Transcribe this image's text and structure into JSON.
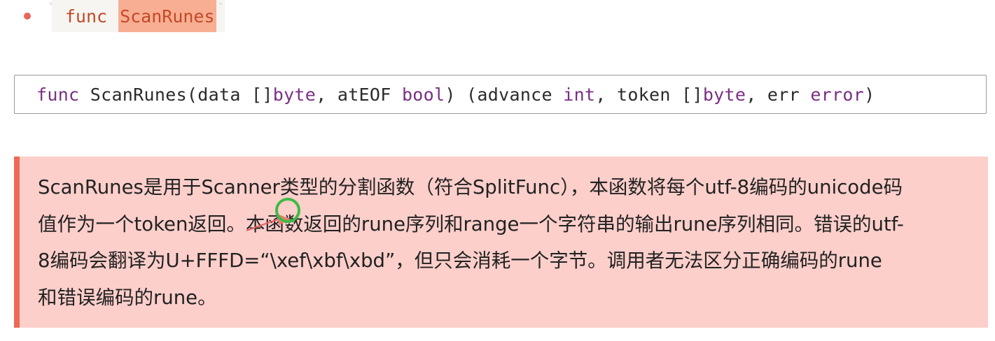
{
  "bullet": {
    "open_tick": "`",
    "keyword": "func",
    "name": "ScanRunes",
    "close_tick": "`"
  },
  "code_block": {
    "tokens": [
      {
        "text": "func",
        "kind": "kw"
      },
      {
        "text": " ScanRunes(data []",
        "kind": "plain"
      },
      {
        "text": "byte",
        "kind": "type"
      },
      {
        "text": ", atEOF ",
        "kind": "plain"
      },
      {
        "text": "bool",
        "kind": "type"
      },
      {
        "text": ") (advance ",
        "kind": "plain"
      },
      {
        "text": "int",
        "kind": "type"
      },
      {
        "text": ", token []",
        "kind": "plain"
      },
      {
        "text": "byte",
        "kind": "type"
      },
      {
        "text": ", err ",
        "kind": "plain"
      },
      {
        "text": "error",
        "kind": "type"
      },
      {
        "text": ")",
        "kind": "plain"
      }
    ]
  },
  "callout": {
    "lines": [
      "ScanRunes是用于Scanner类型的分割函数（符合SplitFunc），本函数将每个utf-8编码的unicode码",
      "值作为一个token返回。本函数返回的rune序列和range一个字符串的输出rune序列相同。错误的utf-",
      "8编码会翻译为U+FFFD=“\\xef\\xbf\\xbd”，但只会消耗一个字节。调用者无法区分正确编码的rune",
      "和错误编码的rune。"
    ]
  },
  "colors": {
    "bullet": "#e4675a",
    "inline_code_text": "#c24a2a",
    "highlight": "#f8ae92",
    "keyword": "#7a2f84",
    "callout_bg": "#fccfcb",
    "callout_border": "#ee6a55",
    "cursor_ring": "#3dbb47"
  },
  "icons": {
    "cursor": "mouse-cursor-highlight-icon"
  }
}
